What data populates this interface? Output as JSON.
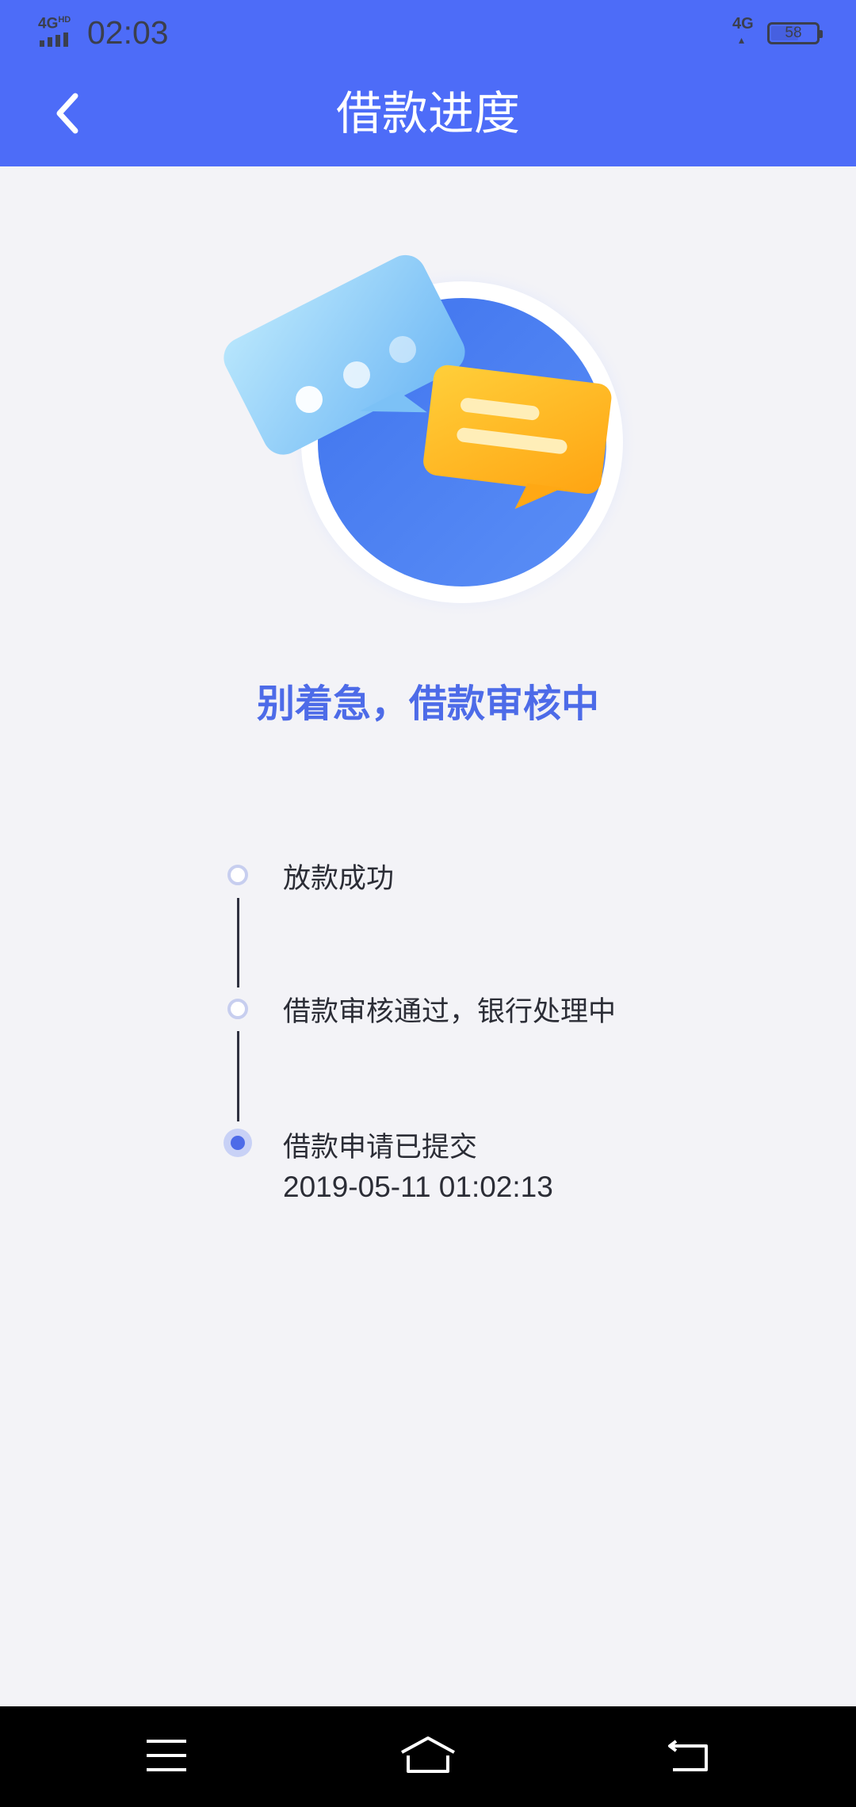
{
  "status_bar": {
    "network_left": "4G",
    "network_left_sup": "HD",
    "time": "02:03",
    "network_right": "4G",
    "battery_level": "58"
  },
  "header": {
    "title": "借款进度",
    "back_icon": "chevron-left-icon"
  },
  "illustration": {
    "icon": "chat-bubbles-illustration",
    "colors": {
      "circle": "#4a7ef2",
      "blue_bubble": "#8fd0f7",
      "yellow_bubble": "#ffb21c"
    }
  },
  "status_message": "别着急，借款审核中",
  "timeline": {
    "steps": [
      {
        "label": "放款成功",
        "state": "pending"
      },
      {
        "label": "借款审核通过，银行处理中",
        "state": "pending"
      },
      {
        "label": "借款申请已提交",
        "time": "2019-05-11 01:02:13",
        "state": "done"
      }
    ]
  },
  "bottom_nav": {
    "menu_icon": "menu-icon",
    "home_icon": "home-icon",
    "back_icon": "back-arrow-icon"
  },
  "colors": {
    "header_bg": "#4d6cf8",
    "accent": "#4d6be8",
    "page_bg": "#f3f3f7"
  }
}
